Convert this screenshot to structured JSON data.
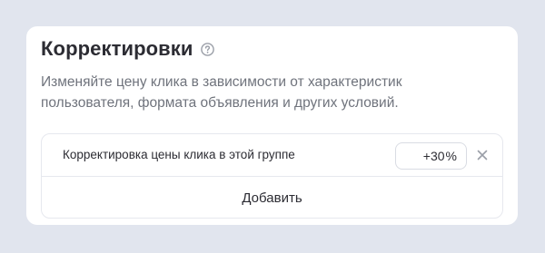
{
  "section": {
    "title": "Корректировки",
    "help_icon": "question-circle-icon",
    "description": "Изменяйте цену клика в зависимости от характеристик пользователя, формата объявления и других условий."
  },
  "adjustment": {
    "label": "Корректировка цены клика в этой группе",
    "value": "+30",
    "unit": "%",
    "remove_icon": "close-icon"
  },
  "actions": {
    "add_label": "Добавить"
  },
  "colors": {
    "page_bg": "#e1e5ee",
    "card_bg": "#ffffff",
    "text_primary": "#2c2c33",
    "text_secondary": "#6f737c",
    "border": "#e6e8ee"
  }
}
